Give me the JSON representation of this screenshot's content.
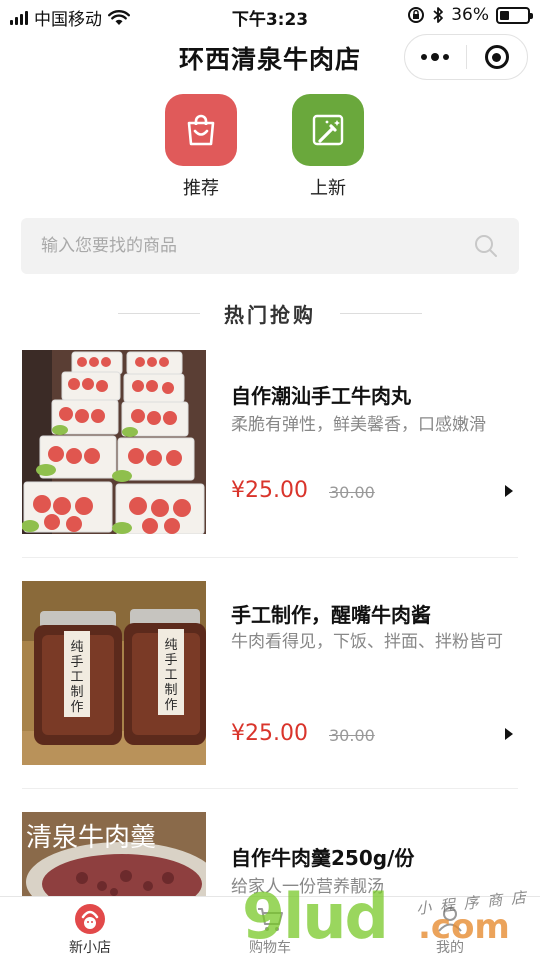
{
  "status_bar": {
    "carrier": "中国移动",
    "time": "下午3:23",
    "battery": "36%",
    "battery_level": 0.36
  },
  "nav": {
    "title": "环西清泉牛肉店",
    "more_icon": "more-dots-icon",
    "close_icon": "target-icon"
  },
  "quick_entries": [
    {
      "label": "推荐",
      "icon": "shopping-bag-icon",
      "color": "#e05a5a"
    },
    {
      "label": "上新",
      "icon": "magic-wand-icon",
      "color": "#6aa83c"
    }
  ],
  "search": {
    "placeholder": "输入您要找的商品"
  },
  "section": {
    "title": "热门抢购"
  },
  "products": [
    {
      "name": "自作潮汕手工牛肉丸",
      "desc": "柔脆有弹性，鲜美馨香，口感嫩滑",
      "price": "¥25.00",
      "original_price": "30.00",
      "image": "beef-balls-photo"
    },
    {
      "name": "手工制作，醒嘴牛肉酱",
      "desc": "牛肉看得见，下饭、拌面、拌粉皆可",
      "price": "¥25.00",
      "original_price": "30.00",
      "image": "beef-sauce-jars-photo",
      "jar_label": "纯手工制作"
    },
    {
      "name": "自作牛肉羹250g/份",
      "desc": "给家人一份营养靓汤",
      "image": "beef-soup-photo",
      "image_caption": "清泉牛肉羹"
    }
  ],
  "tabbar": [
    {
      "label": "新小店",
      "icon": "shop-logo-icon",
      "active": true
    },
    {
      "label": "购物车",
      "icon": "cart-icon",
      "active": false
    },
    {
      "label": "我的",
      "icon": "user-icon",
      "active": false
    }
  ],
  "watermark": {
    "main": "9lud",
    "suffix": ".com",
    "sub": "小 程 序 商 店"
  },
  "colors": {
    "price": "#d9342b",
    "recommend": "#e05a5a",
    "new": "#6aa83c"
  }
}
